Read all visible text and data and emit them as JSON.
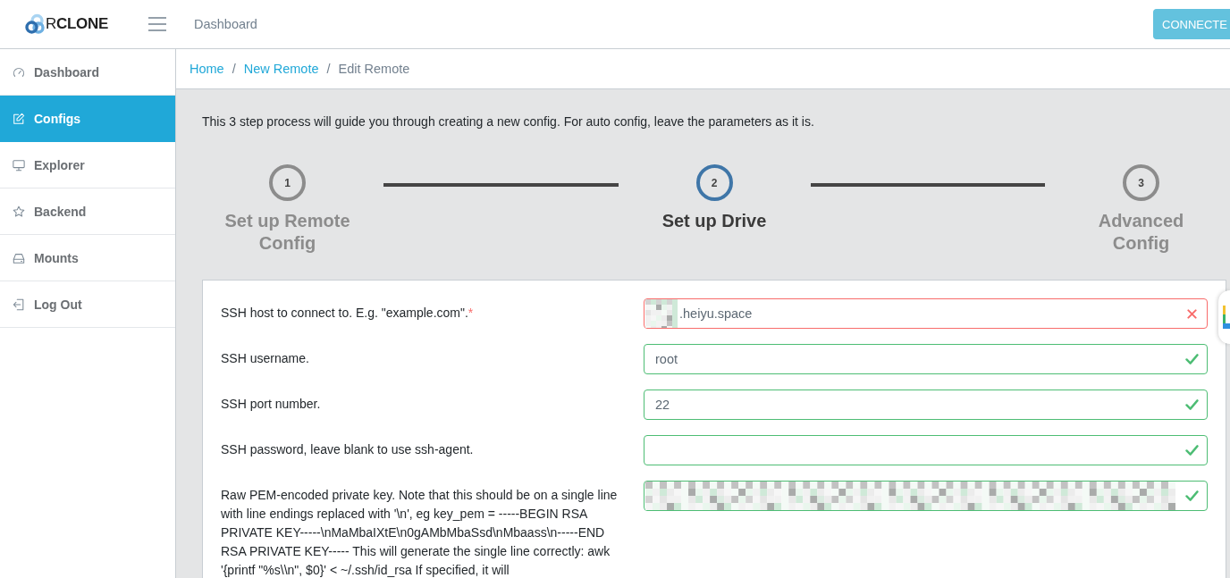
{
  "header": {
    "logo": "R**CLONE**",
    "title": "Dashboard",
    "status_button": "CONNECTE"
  },
  "sidebar": {
    "items": [
      {
        "label": "Dashboard",
        "selected": false
      },
      {
        "label": "Configs",
        "selected": true
      },
      {
        "label": "Explorer",
        "selected": false
      },
      {
        "label": "Backend",
        "selected": false
      },
      {
        "label": "Mounts",
        "selected": false
      },
      {
        "label": "Log Out",
        "selected": false
      }
    ]
  },
  "breadcrumb": [
    {
      "label": "Home",
      "kind": "link"
    },
    {
      "label": "/",
      "kind": "separator"
    },
    {
      "label": "New Remote",
      "kind": "link"
    },
    {
      "label": "/",
      "kind": "separator"
    },
    {
      "label": "Edit Remote",
      "kind": "current"
    }
  ],
  "intro": "This 3 step process will guide you through creating a new config. For auto config, leave the parameters as it is.",
  "steps": [
    {
      "number": "1",
      "title": "Set up Remote Config",
      "active": false
    },
    {
      "number": "2",
      "title": "Set up Drive",
      "active": true
    },
    {
      "number": "3",
      "title": "Advanced Config",
      "active": false
    }
  ],
  "form": {
    "fields": [
      {
        "label": "SSH host to connect to. E.g. \"example.com\".",
        "required_mark": "*",
        "value": ".heiyu.space",
        "redacted": true,
        "valid": false
      },
      {
        "label": "SSH username.",
        "value": "root",
        "redacted": false,
        "valid": true
      },
      {
        "label": "SSH port number.",
        "value": "22",
        "redacted": false,
        "valid": true
      },
      {
        "label": "SSH password, leave blank to use ssh-agent.",
        "redacted": false,
        "valid": true
      },
      {
        "label": "Raw PEM-encoded private key. Note that this should be on a single line with line endings replaced with '\\n', eg key_pem = -----BEGIN RSA PRIVATE KEY-----\\nMaMbaIXtE\\n0gAMbMbaSsd\\nMbaass\\n-----END RSA PRIVATE KEY----- This will generate the single line correctly: awk '{printf \"%s\\\\n\", $0}' < ~/.ssh/id_rsa If specified, it will",
        "redacted": true,
        "valid": true
      }
    ]
  }
}
